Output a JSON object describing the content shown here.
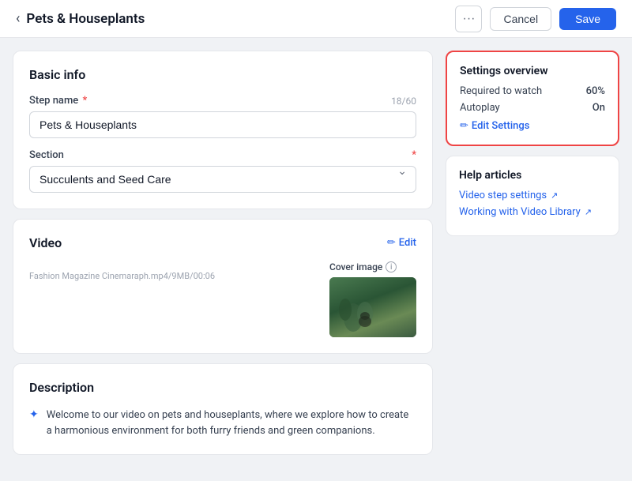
{
  "header": {
    "title": "Pets & Houseplants",
    "back_label": "←",
    "dots_label": "···",
    "cancel_label": "Cancel",
    "save_label": "Save"
  },
  "basic_info": {
    "section_title": "Basic info",
    "step_name_label": "Step name",
    "step_name_value": "Pets & Houseplants",
    "step_name_char_count": "18/60",
    "section_label": "Section",
    "section_value": "Succulents and Seed Care"
  },
  "video": {
    "section_title": "Video",
    "edit_label": "Edit",
    "cover_image_label": "Cover image",
    "video_meta": "Fashion Magazine Cinemaraph.mp4/9MB/00:06",
    "play_label": "▶"
  },
  "description": {
    "section_title": "Description",
    "content": "Welcome to our video on pets and houseplants, where we explore how to create a harmonious environment for both furry friends and green companions."
  },
  "settings_overview": {
    "section_title": "Settings overview",
    "required_to_watch_label": "Required to watch",
    "required_to_watch_value": "60%",
    "autoplay_label": "Autoplay",
    "autoplay_value": "On",
    "edit_settings_label": "Edit Settings"
  },
  "help_articles": {
    "section_title": "Help articles",
    "links": [
      {
        "label": "Video step settings",
        "icon": "↗"
      },
      {
        "label": "Working with Video Library",
        "icon": "↗"
      }
    ]
  }
}
